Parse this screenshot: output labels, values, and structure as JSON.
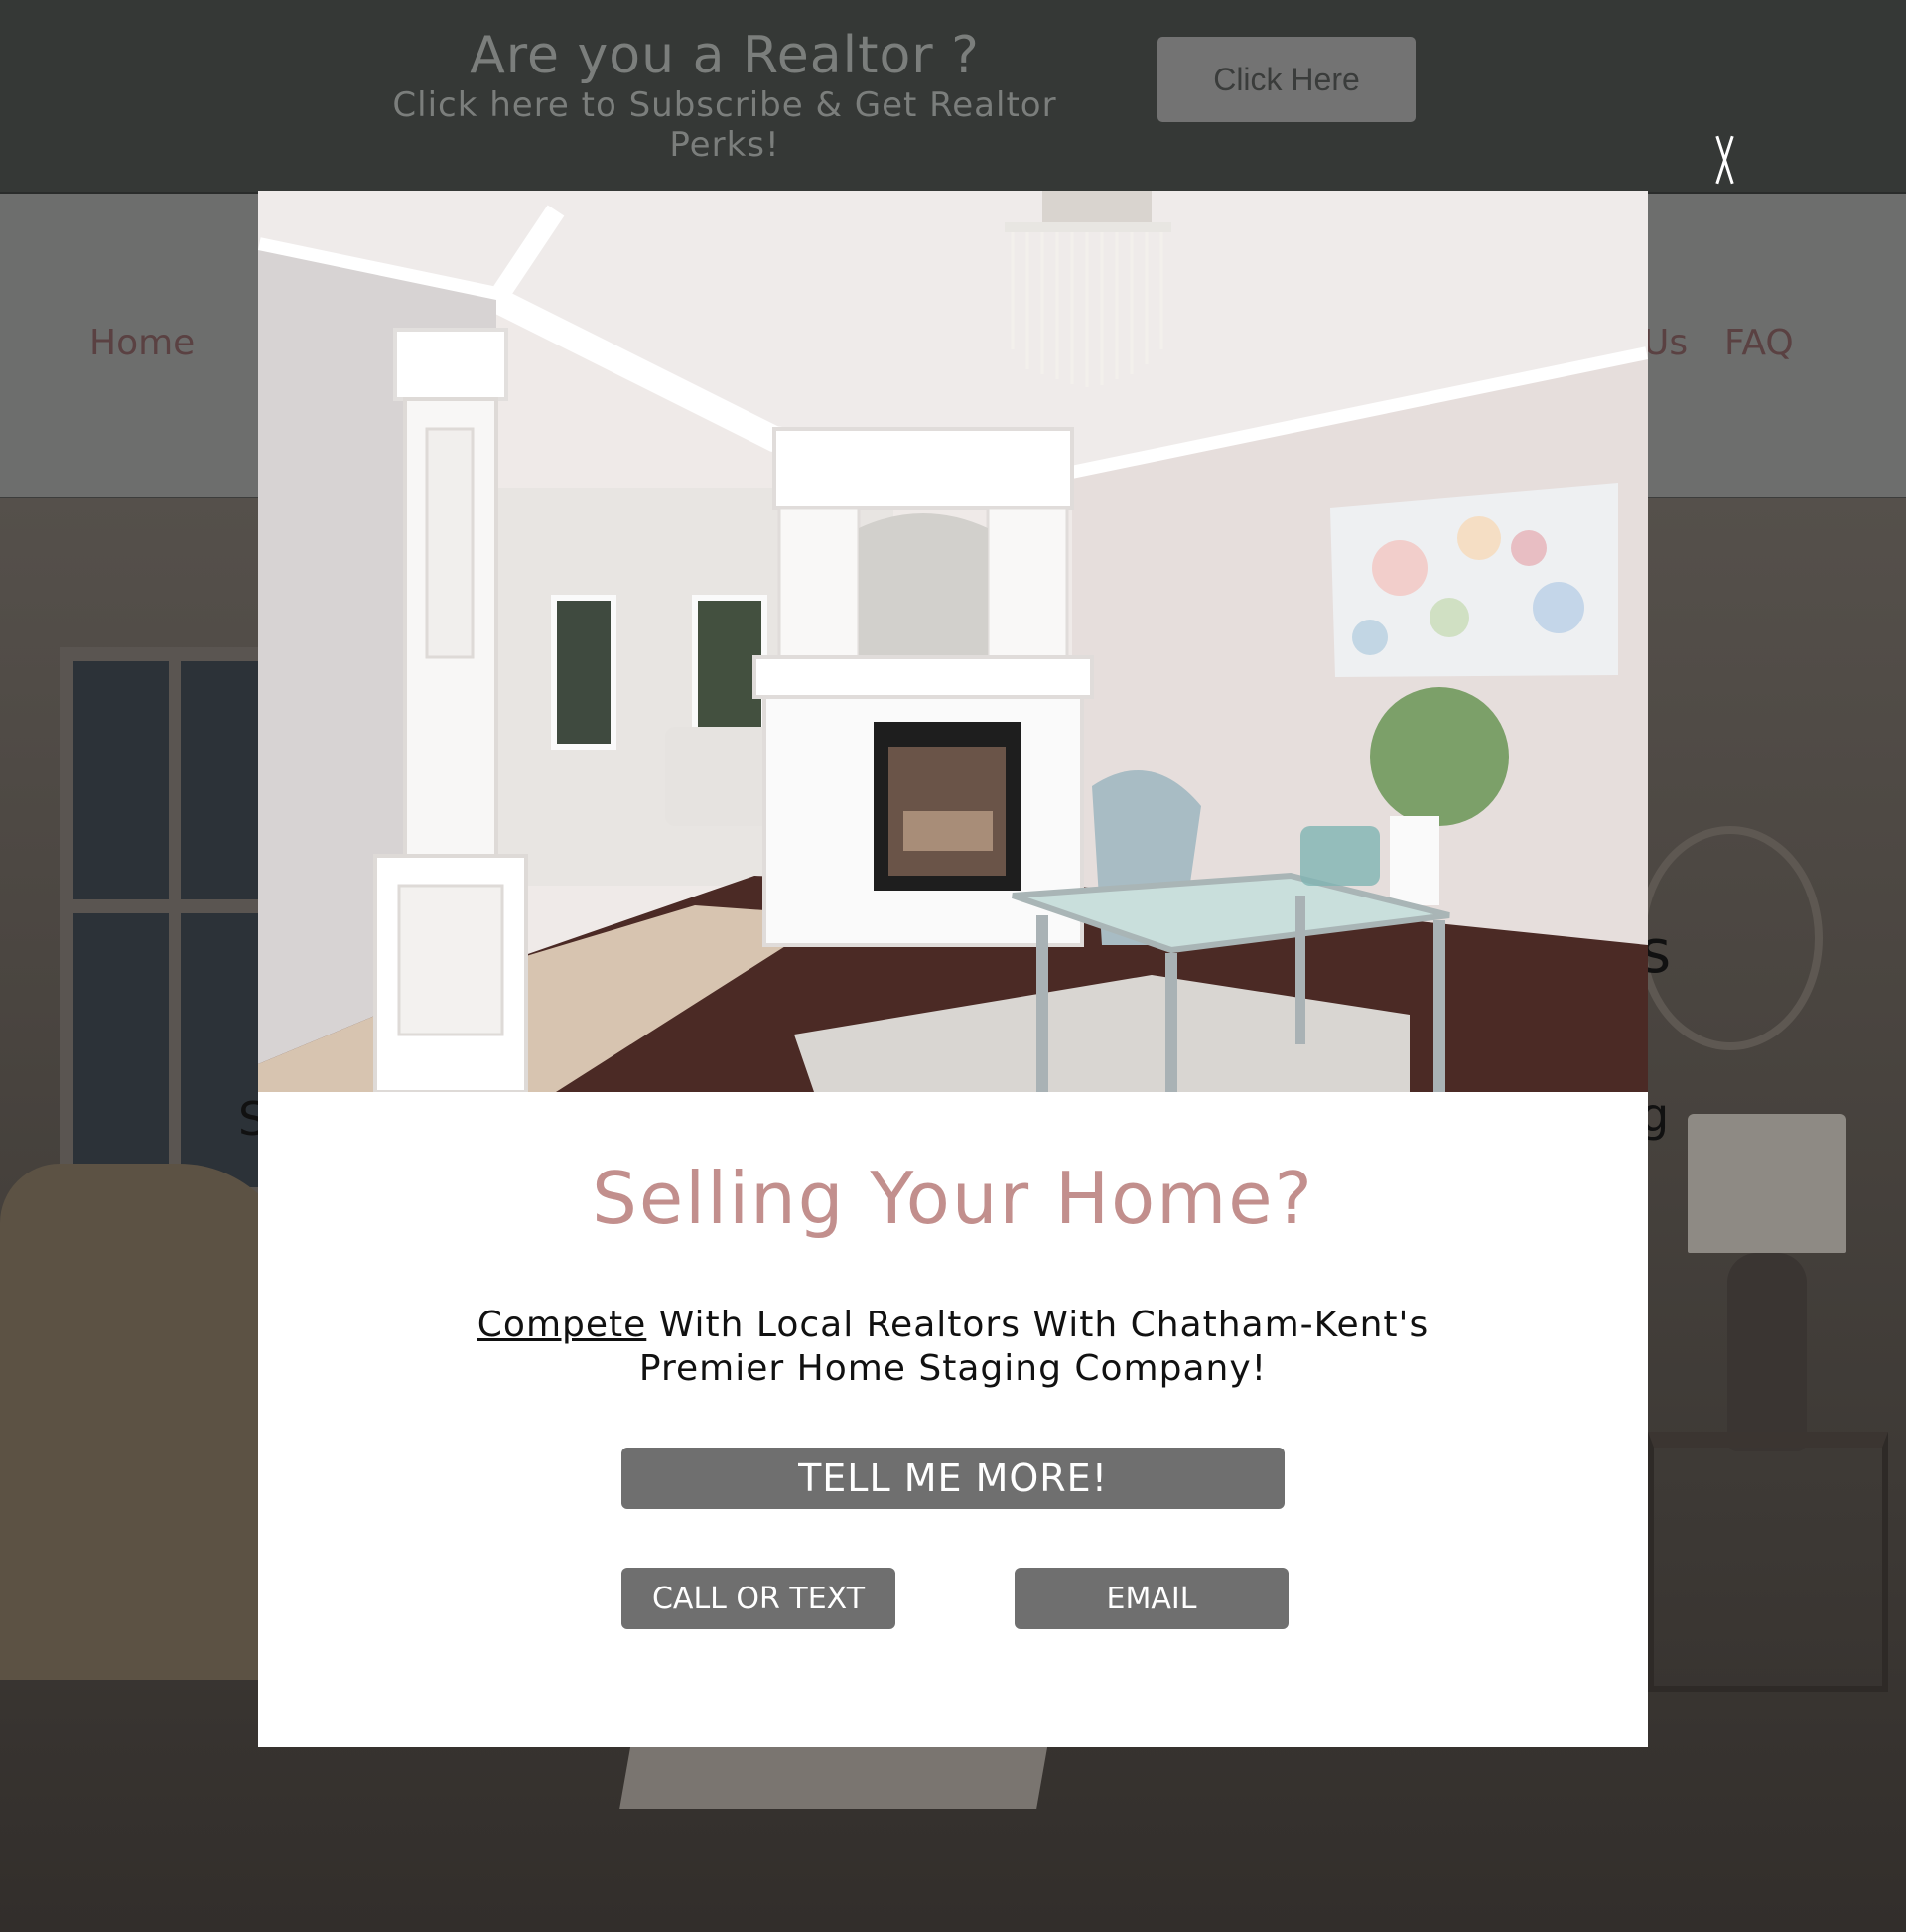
{
  "realtor_banner": {
    "title": "Are you a Realtor ?",
    "subtitle": "Click here to Subscribe & Get Realtor Perks!",
    "button_label": "Click Here",
    "close_label": "X"
  },
  "nav": {
    "items": [
      "Home",
      "Us",
      "FAQ"
    ]
  },
  "hero": {
    "partial_text": [
      "S",
      "s",
      "g"
    ]
  },
  "modal": {
    "title": "Selling Your Home?",
    "description_link": "Compete",
    "description_rest": " With Local Realtors With Chatham-Kent's Premier Home Staging Company!",
    "primary_button": "TELL ME MORE!",
    "call_button": "CALL OR TEXT",
    "email_button": "EMAIL"
  },
  "colors": {
    "banner_bg": "#353836",
    "modal_title": "#c28f8d",
    "button_bg": "#6f6f6f",
    "nav_text": "#5a4142"
  }
}
